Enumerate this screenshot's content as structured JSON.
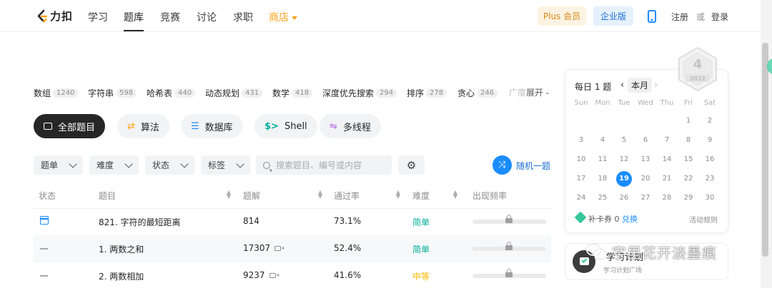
{
  "nav": {
    "logo_text": "力扣",
    "items": [
      "学习",
      "题库",
      "竞赛",
      "讨论",
      "求职"
    ],
    "store": "商店",
    "plus": "Plus 会员",
    "enterprise": "企业版",
    "register": "注册",
    "or": "或",
    "login": "登录"
  },
  "tags": [
    {
      "name": "数组",
      "count": "1240"
    },
    {
      "name": "字符串",
      "count": "598"
    },
    {
      "name": "哈希表",
      "count": "440"
    },
    {
      "name": "动态规划",
      "count": "431"
    },
    {
      "name": "数学",
      "count": "418"
    },
    {
      "name": "深度优先搜索",
      "count": "294"
    },
    {
      "name": "排序",
      "count": "278"
    },
    {
      "name": "贪心",
      "count": "246"
    }
  ],
  "tags_faded": "广度",
  "tags_expand": "展开",
  "categories": [
    {
      "label": "全部题目"
    },
    {
      "label": "算法"
    },
    {
      "label": "数据库"
    },
    {
      "label": "Shell"
    },
    {
      "label": "多线程"
    }
  ],
  "filters": {
    "list": "题单",
    "difficulty": "难度",
    "status": "状态",
    "tags": "标签",
    "search_placeholder": "搜索题目、编号或内容",
    "random": "随机一题"
  },
  "table": {
    "headers": {
      "status": "状态",
      "title": "题目",
      "solutions": "题解",
      "acceptance": "通过率",
      "difficulty": "难度",
      "frequency": "出现频率"
    },
    "rows": [
      {
        "title": "821. 字符的最短距离",
        "solutions": "814",
        "acceptance": "73.1%",
        "difficulty": "简单"
      },
      {
        "title": "1. 两数之和",
        "solutions": "17307",
        "acceptance": "52.4%",
        "difficulty": "简单"
      },
      {
        "title": "2. 两数相加",
        "solutions": "9237",
        "acceptance": "41.6%",
        "difficulty": "中等"
      }
    ]
  },
  "calendar": {
    "title": "每日 1 题",
    "month": "本月",
    "badge_number": "4",
    "badge_year": "2022",
    "weekdays": [
      "Sun",
      "Mon",
      "Tue",
      "Wed",
      "Thu",
      "Fri",
      "Sat"
    ],
    "today": "19",
    "weeks": [
      [
        "",
        "",
        "",
        "",
        "",
        "1",
        "2"
      ],
      [
        "3",
        "4",
        "5",
        "6",
        "7",
        "8",
        "9"
      ],
      [
        "10",
        "11",
        "12",
        "13",
        "14",
        "15",
        "16"
      ],
      [
        "17",
        "18",
        "19",
        "20",
        "21",
        "22",
        "23"
      ],
      [
        "24",
        "25",
        "26",
        "27",
        "28",
        "29",
        "30"
      ]
    ],
    "bk_label": "补卡券 0",
    "bk_link": "兑换",
    "rules": "活动规则"
  },
  "plan": {
    "title": "学习计划",
    "subtitle": "学习计划广场"
  },
  "watermark": "字里花开淡墨痕",
  "colors": {
    "accent": "#1a8cff",
    "store": "#ffa116",
    "easy": "#00af9b",
    "medium": "#ffb800"
  }
}
